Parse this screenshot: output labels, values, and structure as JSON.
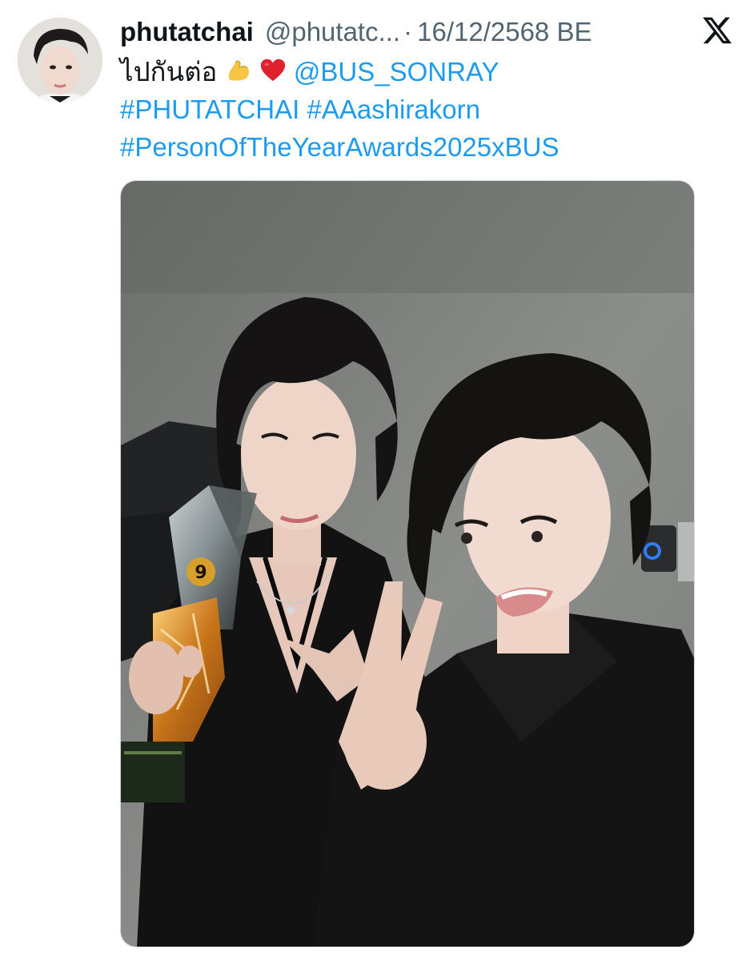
{
  "tweet": {
    "display_name": "phutatchai",
    "handle": "@phutatc...",
    "separator": "·",
    "date": "16/12/2568 BE",
    "text_prefix": "ไปกันต่อ",
    "mention": "@BUS_SONRAY",
    "hashtag_1": "#PHUTATCHAI",
    "hashtag_2": "#AAashirakorn",
    "hashtag_3": "#PersonOfTheYearAwards2025xBUS"
  },
  "icons": {
    "avatar": "avatar-photo",
    "platform": "x-logo-icon",
    "emoji_1": "flexed-biceps-emoji",
    "emoji_2": "red-heart-emoji"
  },
  "colors": {
    "link": "#1d9bf0",
    "secondary_text": "#536471",
    "primary_text": "#0f1419"
  },
  "media": {
    "type": "photo",
    "trophy_number": "9"
  }
}
